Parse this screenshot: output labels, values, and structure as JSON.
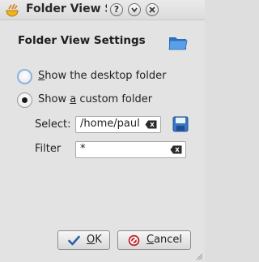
{
  "window": {
    "title": "Folder View S",
    "buttons": {
      "help": "?"
    }
  },
  "heading": "Folder View Settings",
  "options": [
    {
      "prefix": "",
      "mnemonic": "S",
      "rest": "how the desktop folder",
      "selected": false,
      "focused": true
    },
    {
      "prefix": "Show ",
      "mnemonic": "a",
      "rest": " custom folder",
      "selected": true,
      "focused": false
    }
  ],
  "select": {
    "label": "Select:",
    "value": "/home/paul"
  },
  "filter": {
    "label": "Filter",
    "value": "*"
  },
  "actions": {
    "ok": {
      "mnemonic": "O",
      "rest": "K"
    },
    "cancel": {
      "mnemonic": "C",
      "rest": "ancel"
    }
  },
  "colors": {
    "accent_focus": "#8ab4e4",
    "cancel_icon": "#c0272d",
    "ok_check": "#2f5fa8"
  }
}
